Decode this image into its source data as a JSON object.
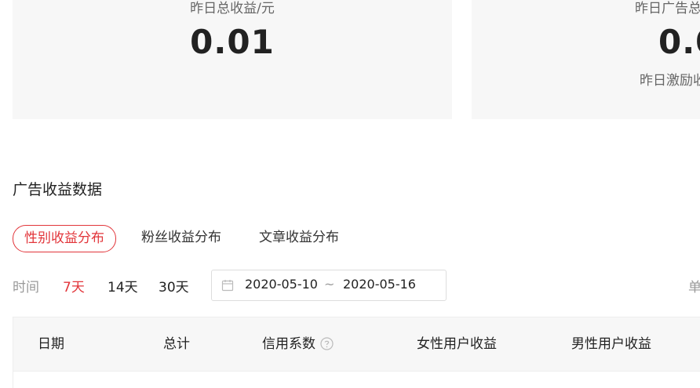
{
  "summary": {
    "left": {
      "label": "昨日总收益/元",
      "value": "0.01"
    },
    "right": {
      "label": "昨日广告总",
      "value": "0.0",
      "sub_label": "昨日激励收"
    }
  },
  "ad_income": {
    "title": "广告收益数据",
    "tabs": [
      {
        "label": "性别收益分布",
        "active": true
      },
      {
        "label": "粉丝收益分布",
        "active": false
      },
      {
        "label": "文章收益分布",
        "active": false
      }
    ]
  },
  "filter": {
    "time_label": "时间",
    "ranges": [
      {
        "label": "7天",
        "active": true
      },
      {
        "label": "14天",
        "active": false
      },
      {
        "label": "30天",
        "active": false
      }
    ],
    "date_start": "2020-05-10",
    "date_separator": "~",
    "date_end": "2020-05-16",
    "unit_label": "单"
  },
  "table": {
    "columns": [
      "日期",
      "总计",
      "信用系数",
      "女性用户收益",
      "男性用户收益"
    ]
  },
  "colors": {
    "accent": "#e2353a",
    "card_bg": "#f7f7f7",
    "muted": "#999999"
  }
}
